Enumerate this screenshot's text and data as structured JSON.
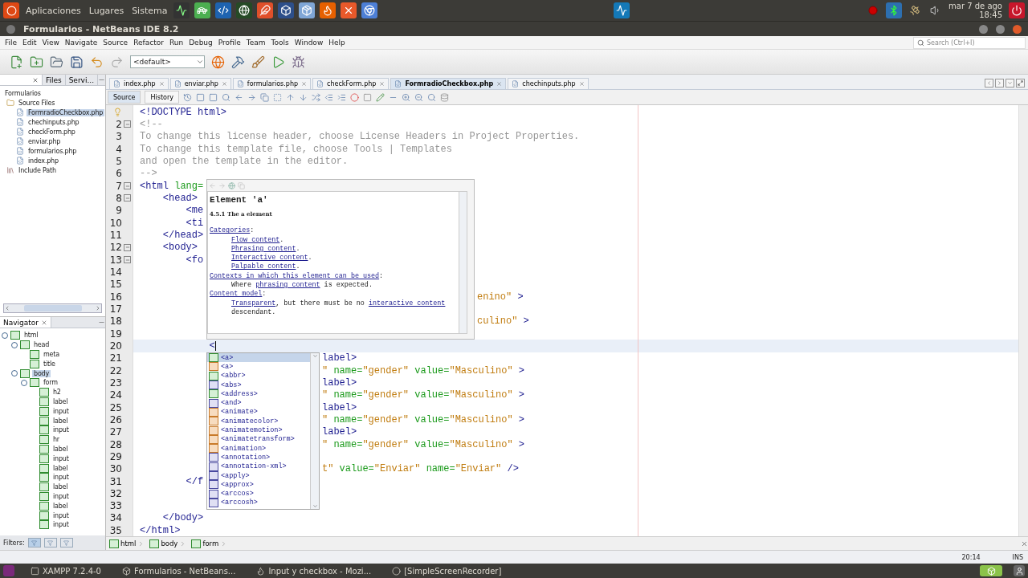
{
  "top_panel": {
    "menus": [
      "Aplicaciones",
      "Lugares",
      "Sistema"
    ],
    "clock_date": "mar  7 de ago",
    "clock_time": "18:45"
  },
  "window": {
    "title": "Formularios - NetBeans IDE 8.2"
  },
  "menu_bar": [
    "File",
    "Edit",
    "View",
    "Navigate",
    "Source",
    "Refactor",
    "Run",
    "Debug",
    "Profile",
    "Team",
    "Tools",
    "Window",
    "Help"
  ],
  "search": {
    "placeholder": "Search (Ctrl+I)"
  },
  "toolbar": {
    "configuration": "<default>"
  },
  "projects": {
    "tabs": [
      {
        "closable": true,
        "selected": true
      },
      {
        "label": "Files",
        "selected": false
      },
      {
        "label": "Servi...",
        "selected": false
      }
    ],
    "tree": [
      {
        "label": "Formularios",
        "selected": false,
        "children": [
          {
            "label": "Source Files",
            "kind": "folder",
            "selected": false,
            "children": [
              {
                "label": "FormradioCheckbox.php",
                "kind": "file",
                "selected": true
              },
              {
                "label": "chechinputs.php",
                "kind": "file",
                "selected": false
              },
              {
                "label": "checkForm.php",
                "kind": "file",
                "selected": false
              },
              {
                "label": "enviar.php",
                "kind": "file",
                "selected": false
              },
              {
                "label": "formularios.php",
                "kind": "file",
                "selected": false
              },
              {
                "label": "index.php",
                "kind": "file",
                "selected": false
              }
            ]
          },
          {
            "label": "Include Path",
            "kind": "library",
            "selected": false
          }
        ]
      }
    ]
  },
  "navigator": {
    "title": "Navigator",
    "filters_label": "Filters:",
    "filters": [
      {
        "selected": true
      },
      {
        "selected": false
      },
      {
        "selected": false
      }
    ],
    "tree": [
      {
        "label": "html",
        "selected": false,
        "expanded": true,
        "children": [
          {
            "label": "head",
            "selected": false,
            "expanded": true,
            "children": [
              {
                "label": "meta",
                "selected": false
              },
              {
                "label": "title",
                "selected": false
              }
            ]
          },
          {
            "label": "body",
            "selected": true,
            "expanded": true,
            "children": [
              {
                "label": "form",
                "selected": false,
                "expanded": true,
                "children": [
                  {
                    "label": "h2",
                    "selected": false
                  },
                  {
                    "label": "label",
                    "selected": false
                  },
                  {
                    "label": "input",
                    "selected": false
                  },
                  {
                    "label": "label",
                    "selected": false
                  },
                  {
                    "label": "input",
                    "selected": false
                  },
                  {
                    "label": "hr",
                    "selected": false
                  },
                  {
                    "label": "label",
                    "selected": false
                  },
                  {
                    "label": "input",
                    "selected": false
                  },
                  {
                    "label": "label",
                    "selected": false
                  },
                  {
                    "label": "input",
                    "selected": false
                  },
                  {
                    "label": "label",
                    "selected": false
                  },
                  {
                    "label": "input",
                    "selected": false
                  },
                  {
                    "label": "label",
                    "selected": false
                  },
                  {
                    "label": "input",
                    "selected": false
                  },
                  {
                    "label": "input",
                    "selected": false
                  }
                ]
              }
            ]
          }
        ]
      }
    ]
  },
  "editor": {
    "tabs": [
      {
        "label": "index.php",
        "selected": false
      },
      {
        "label": "enviar.php",
        "selected": false
      },
      {
        "label": "formularios.php",
        "selected": false
      },
      {
        "label": "checkForm.php",
        "selected": false
      },
      {
        "label": "FormradioCheckbox.php",
        "selected": true
      },
      {
        "label": "chechinputs.php",
        "selected": false
      }
    ],
    "views": [
      {
        "label": "Source",
        "selected": true
      },
      {
        "label": "History",
        "selected": false
      }
    ],
    "lines": [
      {
        "hint": true,
        "fold": false,
        "current": false,
        "left": [
          {
            "kind": "tag",
            "text": "<!DOCTYPE html>"
          }
        ]
      },
      {
        "number": "2",
        "fold": true,
        "current": false,
        "left": [
          {
            "kind": "comment",
            "text": "<!--"
          }
        ]
      },
      {
        "number": "3",
        "fold": false,
        "current": false,
        "left": [
          {
            "kind": "comment",
            "text": "To change this license header, choose License Headers in Project Properties."
          }
        ]
      },
      {
        "number": "4",
        "fold": false,
        "current": false,
        "left": [
          {
            "kind": "comment",
            "text": "To change this template file, choose Tools | Templates"
          }
        ]
      },
      {
        "number": "5",
        "fold": false,
        "current": false,
        "left": [
          {
            "kind": "comment",
            "text": "and open the template in the editor."
          }
        ]
      },
      {
        "number": "6",
        "fold": false,
        "current": false,
        "left": [
          {
            "kind": "comment",
            "text": "-->"
          }
        ]
      },
      {
        "number": "7",
        "fold": true,
        "current": false,
        "left": [
          {
            "kind": "tag",
            "text": "<html"
          },
          {
            "kind": "attr",
            "text": " lang="
          }
        ]
      },
      {
        "number": "8",
        "fold": true,
        "current": false,
        "left": [
          {
            "kind": "tag",
            "text": "    <head>"
          }
        ]
      },
      {
        "number": "9",
        "fold": false,
        "current": false,
        "left": [
          {
            "kind": "tag",
            "text": "        <me"
          }
        ]
      },
      {
        "number": "10",
        "fold": false,
        "current": false,
        "left": [
          {
            "kind": "tag",
            "text": "        <ti"
          }
        ]
      },
      {
        "number": "11",
        "fold": false,
        "current": false,
        "left": [
          {
            "kind": "tag",
            "text": "    </head>"
          }
        ]
      },
      {
        "number": "12",
        "fold": true,
        "current": false,
        "left": [
          {
            "kind": "tag",
            "text": "    <body>"
          }
        ]
      },
      {
        "number": "13",
        "fold": true,
        "current": false,
        "left": [
          {
            "kind": "tag",
            "text": "        <fo"
          }
        ]
      },
      {
        "number": "14",
        "fold": false,
        "current": false
      },
      {
        "number": "15",
        "fold": false,
        "current": false
      },
      {
        "number": "16",
        "fold": false,
        "current": false,
        "right": [
          {
            "kind": "value",
            "text": "enino\""
          },
          {
            "kind": "tag",
            "text": " >"
          }
        ]
      },
      {
        "number": "17",
        "fold": false,
        "current": false
      },
      {
        "number": "18",
        "fold": false,
        "current": false,
        "right": [
          {
            "kind": "value",
            "text": "culino\""
          },
          {
            "kind": "tag",
            "text": " >"
          }
        ]
      },
      {
        "number": "19",
        "fold": false,
        "current": false
      },
      {
        "number": "20",
        "fold": false,
        "current": true,
        "left": [
          {
            "kind": "tag",
            "text": "            <"
          }
        ]
      },
      {
        "number": "21",
        "fold": false,
        "current": false,
        "right": [
          {
            "kind": "tag",
            "text": "label>"
          }
        ]
      },
      {
        "number": "22",
        "fold": false,
        "current": false,
        "right": [
          {
            "kind": "value",
            "text": "\""
          },
          {
            "kind": "attr",
            "text": " name="
          },
          {
            "kind": "value",
            "text": "\"gender\""
          },
          {
            "kind": "attr",
            "text": " value="
          },
          {
            "kind": "value",
            "text": "\"Masculino\""
          },
          {
            "kind": "tag",
            "text": " >"
          }
        ]
      },
      {
        "number": "23",
        "fold": false,
        "current": false,
        "right": [
          {
            "kind": "tag",
            "text": "label>"
          }
        ]
      },
      {
        "number": "24",
        "fold": false,
        "current": false,
        "right": [
          {
            "kind": "value",
            "text": "\""
          },
          {
            "kind": "attr",
            "text": " name="
          },
          {
            "kind": "value",
            "text": "\"gender\""
          },
          {
            "kind": "attr",
            "text": " value="
          },
          {
            "kind": "value",
            "text": "\"Masculino\""
          },
          {
            "kind": "tag",
            "text": " >"
          }
        ]
      },
      {
        "number": "25",
        "fold": false,
        "current": false,
        "right": [
          {
            "kind": "tag",
            "text": "label>"
          }
        ]
      },
      {
        "number": "26",
        "fold": false,
        "current": false,
        "right": [
          {
            "kind": "value",
            "text": "\""
          },
          {
            "kind": "attr",
            "text": " name="
          },
          {
            "kind": "value",
            "text": "\"gender\""
          },
          {
            "kind": "attr",
            "text": " value="
          },
          {
            "kind": "value",
            "text": "\"Masculino\""
          },
          {
            "kind": "tag",
            "text": " >"
          }
        ]
      },
      {
        "number": "27",
        "fold": false,
        "current": false,
        "right": [
          {
            "kind": "tag",
            "text": "label>"
          }
        ]
      },
      {
        "number": "28",
        "fold": false,
        "current": false,
        "right": [
          {
            "kind": "value",
            "text": "\""
          },
          {
            "kind": "attr",
            "text": " name="
          },
          {
            "kind": "value",
            "text": "\"gender\""
          },
          {
            "kind": "attr",
            "text": " value="
          },
          {
            "kind": "value",
            "text": "\"Masculino\""
          },
          {
            "kind": "tag",
            "text": " >"
          }
        ]
      },
      {
        "number": "29",
        "fold": false,
        "current": false
      },
      {
        "number": "30",
        "fold": false,
        "current": false,
        "right": [
          {
            "kind": "value",
            "text": "t\""
          },
          {
            "kind": "attr",
            "text": " value="
          },
          {
            "kind": "value",
            "text": "\"Enviar\""
          },
          {
            "kind": "attr",
            "text": " name="
          },
          {
            "kind": "value",
            "text": "\"Enviar\""
          },
          {
            "kind": "tag",
            "text": " />"
          }
        ]
      },
      {
        "number": "31",
        "fold": false,
        "current": false,
        "left": [
          {
            "kind": "tag",
            "text": "        </f"
          }
        ]
      },
      {
        "number": "32",
        "fold": false,
        "current": false
      },
      {
        "number": "33",
        "fold": false,
        "current": false
      },
      {
        "number": "34",
        "fold": false,
        "current": false,
        "left": [
          {
            "kind": "tag",
            "text": "    </body>"
          }
        ]
      },
      {
        "number": "35",
        "fold": false,
        "current": false,
        "left": [
          {
            "kind": "tag",
            "text": "</html>"
          }
        ]
      }
    ],
    "documentation": [
      {
        "kind": "heading",
        "parts": [
          {
            "text": "Element 'a'",
            "link": false
          }
        ]
      },
      {
        "kind": "subheading",
        "parts": [
          {
            "text": "4.5.1 The a element",
            "link": false
          }
        ]
      },
      {
        "kind": "line",
        "parts": [
          {
            "text": "Categories",
            "link": true
          },
          {
            "text": ":",
            "link": false
          }
        ]
      },
      {
        "kind": "item",
        "parts": [
          {
            "text": "Flow content",
            "link": true
          },
          {
            "text": ".",
            "link": false
          }
        ]
      },
      {
        "kind": "item",
        "parts": [
          {
            "text": "Phrasing content",
            "link": true
          },
          {
            "text": ".",
            "link": false
          }
        ]
      },
      {
        "kind": "item",
        "parts": [
          {
            "text": "Interactive content",
            "link": true
          },
          {
            "text": ".",
            "link": false
          }
        ]
      },
      {
        "kind": "item",
        "parts": [
          {
            "text": "Palpable content",
            "link": true
          },
          {
            "text": ".",
            "link": false
          }
        ]
      },
      {
        "kind": "line",
        "parts": [
          {
            "text": "Contexts in which this element can be used",
            "link": true
          },
          {
            "text": ":",
            "link": false
          }
        ]
      },
      {
        "kind": "item",
        "parts": [
          {
            "text": "Where ",
            "link": false
          },
          {
            "text": "phrasing content",
            "link": true
          },
          {
            "text": " is expected.",
            "link": false
          }
        ]
      },
      {
        "kind": "line",
        "parts": [
          {
            "text": "Content model",
            "link": true
          },
          {
            "text": ":",
            "link": false
          }
        ]
      },
      {
        "kind": "item",
        "parts": [
          {
            "text": "Transparent",
            "link": true
          },
          {
            "text": ", but there must be no ",
            "link": false
          },
          {
            "text": "interactive content",
            "link": true
          }
        ]
      },
      {
        "kind": "item",
        "parts": [
          {
            "text": "descendant.",
            "link": false
          }
        ]
      }
    ],
    "completion": [
      {
        "label": "<a>",
        "kind": "html",
        "selected": true
      },
      {
        "label": "<a>",
        "kind": "svg",
        "selected": false
      },
      {
        "label": "<abbr>",
        "kind": "html",
        "selected": false
      },
      {
        "label": "<abs>",
        "kind": "math",
        "selected": false
      },
      {
        "label": "<address>",
        "kind": "html",
        "selected": false
      },
      {
        "label": "<and>",
        "kind": "math",
        "selected": false
      },
      {
        "label": "<animate>",
        "kind": "svg",
        "selected": false
      },
      {
        "label": "<animatecolor>",
        "kind": "svg",
        "selected": false
      },
      {
        "label": "<animatemotion>",
        "kind": "svg",
        "selected": false
      },
      {
        "label": "<animatetransform>",
        "kind": "svg",
        "selected": false
      },
      {
        "label": "<animation>",
        "kind": "svg",
        "selected": false
      },
      {
        "label": "<annotation>",
        "kind": "math",
        "selected": false
      },
      {
        "label": "<annotation-xml>",
        "kind": "math",
        "selected": false
      },
      {
        "label": "<apply>",
        "kind": "math",
        "selected": false
      },
      {
        "label": "<approx>",
        "kind": "math",
        "selected": false
      },
      {
        "label": "<arccos>",
        "kind": "math",
        "selected": false
      },
      {
        "label": "<arccosh>",
        "kind": "math",
        "selected": false
      }
    ],
    "breadcrumbs": [
      "html",
      "body",
      "form"
    ]
  },
  "status_bar": {
    "position": "20:14",
    "mode": "INS"
  },
  "taskbar": [
    {
      "label": "XAMPP 7.2.4-0",
      "kind": "window"
    },
    {
      "label": "Formularios - NetBeans...",
      "kind": "cube"
    },
    {
      "label": "Input y checkbox - Mozi...",
      "kind": "browser"
    },
    {
      "label": "[SimpleScreenRecorder]",
      "kind": "recorder"
    }
  ]
}
